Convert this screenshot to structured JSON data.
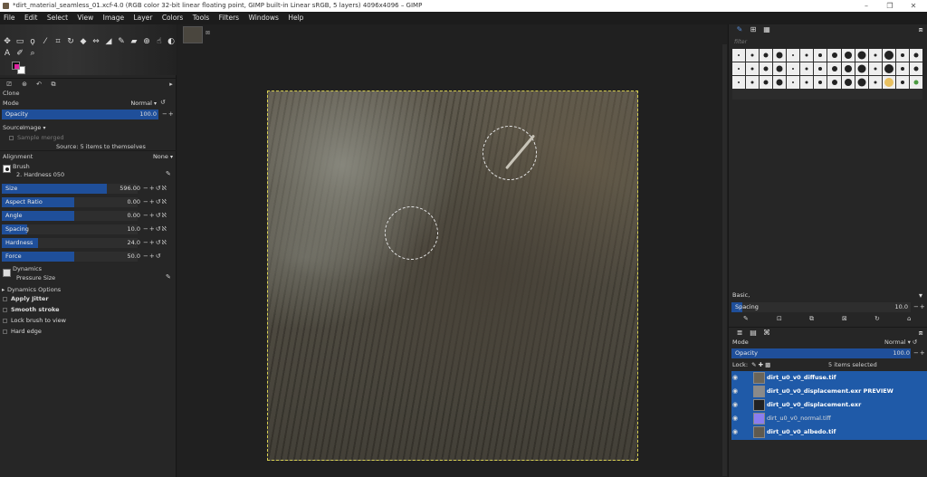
{
  "window": {
    "title": "*dirt_material_seamless_01.xcf-4.0 (RGB color 32-bit linear floating point, GIMP built-in Linear sRGB, 5 layers) 4096x4096 – GIMP",
    "controls": [
      "–",
      "❐",
      "✕"
    ]
  },
  "menu": [
    "File",
    "Edit",
    "Select",
    "View",
    "Image",
    "Layer",
    "Colors",
    "Tools",
    "Filters",
    "Windows",
    "Help"
  ],
  "tool_options": {
    "heading": "Clone",
    "mode_label": "Mode",
    "mode_value": "Normal",
    "opacity_label": "Opacity",
    "opacity_value": "100.0",
    "source_label": "Source",
    "source_value": "Image",
    "sample_merged_label": "Sample merged",
    "source_info": "Source: 5 items to themselves",
    "alignment_label": "Alignment",
    "alignment_value": "None",
    "brush_label": "Brush",
    "brush_value": "2. Hardness 050",
    "size_label": "Size",
    "size_value": "596.00",
    "aspect_label": "Aspect Ratio",
    "aspect_value": "0.00",
    "angle_label": "Angle",
    "angle_value": "0.00",
    "spacing_label": "Spacing",
    "spacing_value": "10.0",
    "hardness_label": "Hardness",
    "hardness_value": "24.0",
    "force_label": "Force",
    "force_value": "50.0",
    "dynamics_label": "Dynamics",
    "dynamics_value": "Pressure Size",
    "dynamics_options_label": "Dynamics Options",
    "apply_jitter_label": "Apply Jitter",
    "smooth_stroke_label": "Smooth stroke",
    "lock_brush_label": "Lock brush to view",
    "hard_edge_label": "Hard edge"
  },
  "brushes": {
    "filter_placeholder": "filter",
    "preset_label": "Basic,",
    "spacing_label": "Spacing",
    "spacing_value": "10.0"
  },
  "layers": {
    "mode_label": "Mode",
    "mode_value": "Normal",
    "opacity_label": "Opacity",
    "opacity_value": "100.0",
    "lock_label": "Lock:",
    "selected_info": "5 items selected",
    "items": [
      {
        "name": "dirt_u0_v0_diffuse.tif",
        "bold": true,
        "thumb": "#6b6558"
      },
      {
        "name": "dirt_u0_v0_displacement.exr PREVIEW",
        "bold": true,
        "thumb": "#8a8a8a"
      },
      {
        "name": "dirt_u0_v0_displacement.exr",
        "bold": true,
        "thumb": "#222222"
      },
      {
        "name": "dirt_u0_v0_normal.tiff",
        "bold": false,
        "thumb": "#8a7df0"
      },
      {
        "name": "dirt_u0_v0_albedo.tif",
        "bold": true,
        "thumb": "#5f5a4f"
      }
    ]
  },
  "colors": {
    "accent": "#1f5aa8",
    "foreground": "#111111",
    "background": "#ffffff"
  }
}
